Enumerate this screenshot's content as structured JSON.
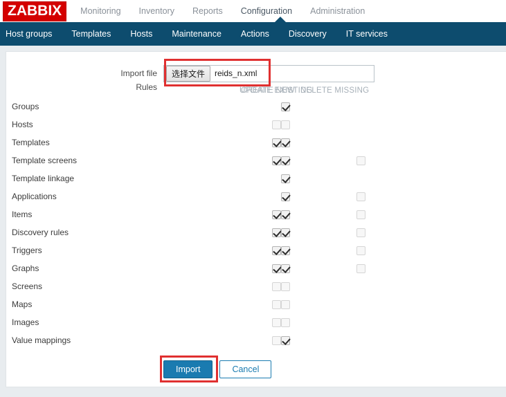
{
  "brand": {
    "logo_text": "ZABBIX",
    "logo_bg": "#d40000"
  },
  "main_nav": {
    "items": [
      {
        "label": "Monitoring",
        "active": false
      },
      {
        "label": "Inventory",
        "active": false
      },
      {
        "label": "Reports",
        "active": false
      },
      {
        "label": "Configuration",
        "active": true
      },
      {
        "label": "Administration",
        "active": false
      }
    ]
  },
  "sub_nav": {
    "bg": "#0d4c6e",
    "items": [
      {
        "label": "Host groups"
      },
      {
        "label": "Templates"
      },
      {
        "label": "Hosts"
      },
      {
        "label": "Maintenance"
      },
      {
        "label": "Actions"
      },
      {
        "label": "Discovery"
      },
      {
        "label": "IT services"
      }
    ]
  },
  "form": {
    "import_file": {
      "label": "Import file",
      "browse_button": "选择文件",
      "file_name": "reids_n.xml",
      "highlighted": true,
      "highlight_color": "#e03030"
    },
    "rules": {
      "label": "Rules",
      "columns": [
        "UPDATE EXISTING",
        "CREATE NEW",
        "DELETE MISSING"
      ],
      "rows": [
        {
          "name": "Groups",
          "update_existing": null,
          "create_new": true,
          "delete_missing": null
        },
        {
          "name": "Hosts",
          "update_existing": false,
          "create_new": false,
          "delete_missing": null
        },
        {
          "name": "Templates",
          "update_existing": true,
          "create_new": true,
          "delete_missing": null
        },
        {
          "name": "Template screens",
          "update_existing": true,
          "create_new": true,
          "delete_missing": false
        },
        {
          "name": "Template linkage",
          "update_existing": null,
          "create_new": true,
          "delete_missing": null
        },
        {
          "name": "Applications",
          "update_existing": null,
          "create_new": true,
          "delete_missing": false
        },
        {
          "name": "Items",
          "update_existing": true,
          "create_new": true,
          "delete_missing": false
        },
        {
          "name": "Discovery rules",
          "update_existing": true,
          "create_new": true,
          "delete_missing": false
        },
        {
          "name": "Triggers",
          "update_existing": true,
          "create_new": true,
          "delete_missing": false
        },
        {
          "name": "Graphs",
          "update_existing": true,
          "create_new": true,
          "delete_missing": false
        },
        {
          "name": "Screens",
          "update_existing": false,
          "create_new": false,
          "delete_missing": null
        },
        {
          "name": "Maps",
          "update_existing": false,
          "create_new": false,
          "delete_missing": null
        },
        {
          "name": "Images",
          "update_existing": false,
          "create_new": false,
          "delete_missing": null
        },
        {
          "name": "Value mappings",
          "update_existing": false,
          "create_new": true,
          "delete_missing": null
        }
      ]
    },
    "actions": {
      "submit_label": "Import",
      "cancel_label": "Cancel",
      "submit_highlighted": true,
      "submit_color": "#1a7bb0"
    }
  }
}
